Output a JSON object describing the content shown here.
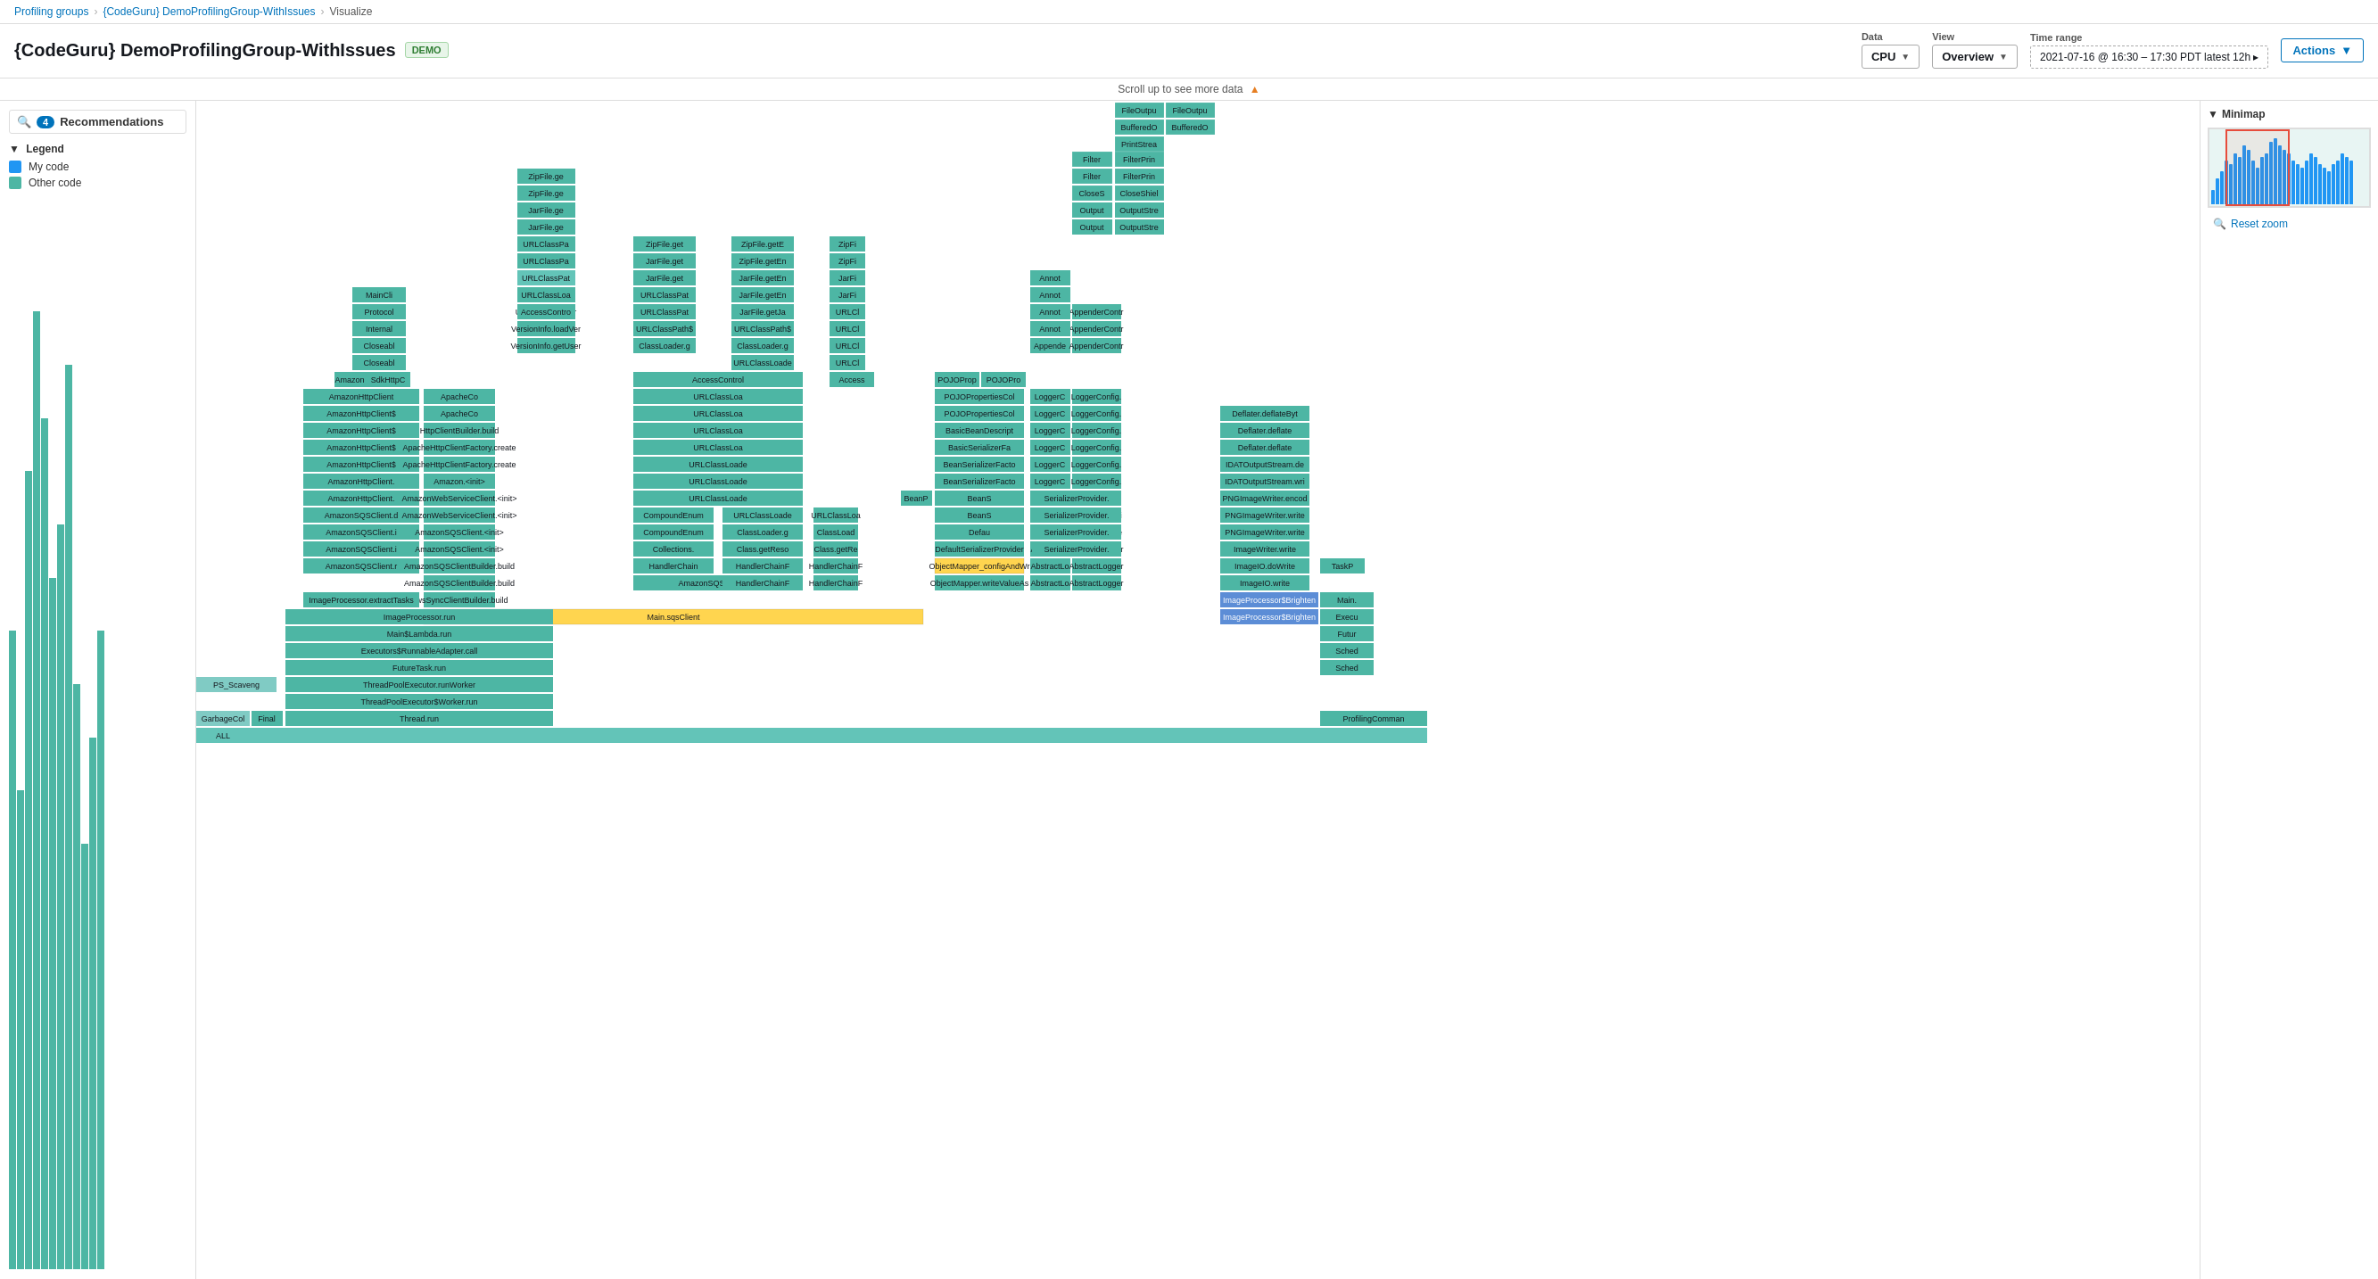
{
  "breadcrumbs": {
    "item1": "Profiling groups",
    "item2": "{CodeGuru} DemoProfilingGroup-WithIssues",
    "item3": "Visualize"
  },
  "page": {
    "title": "{CodeGuru} DemoProfilingGroup-WithIssues",
    "badge": "DEMO"
  },
  "controls": {
    "data_label": "Data",
    "data_value": "CPU",
    "view_label": "View",
    "view_value": "Overview",
    "time_label": "Time range",
    "time_value": "2021-07-16 @ 16:30 – 17:30 PDT  latest 12h ▸",
    "actions_label": "Actions"
  },
  "scroll_notice": "Scroll up to see more data",
  "legend": {
    "title": "Legend",
    "items": [
      {
        "label": "My code",
        "color": "#2196F3"
      },
      {
        "label": "Other code",
        "color": "#4db6a4"
      }
    ]
  },
  "recommendations": {
    "count": "4",
    "label": "Recommendations"
  },
  "minimap": {
    "title": "Minimap",
    "reset_zoom": "Reset zoom"
  },
  "minimap_bars": [
    20,
    35,
    45,
    60,
    55,
    70,
    65,
    80,
    75,
    60,
    50,
    65,
    70,
    85,
    90,
    80,
    75,
    70,
    60,
    55,
    50,
    60,
    70,
    65,
    55,
    50,
    45,
    55,
    60,
    70,
    65,
    60
  ],
  "flame_rows": [
    {
      "cells": [
        {
          "label": "FileOutpu",
          "color": "c-teal",
          "left": "78.5%",
          "width": "4%"
        },
        {
          "label": "FileOutpu",
          "color": "c-teal",
          "left": "82.6%",
          "width": "4%"
        }
      ]
    }
  ],
  "status_items": [
    {
      "label": "PS_Scaveng"
    },
    {
      "label": "GarbageCol"
    },
    {
      "label": "Final"
    },
    {
      "label": "ALL"
    }
  ],
  "notable_labels": {
    "beans": "BeanS",
    "access": "Access",
    "collections": "Collections"
  }
}
